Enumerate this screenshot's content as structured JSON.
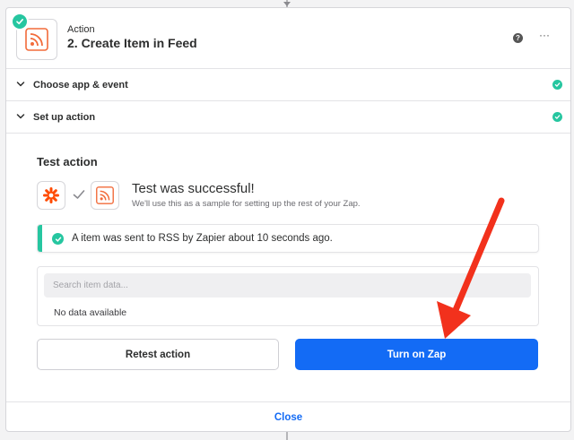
{
  "header": {
    "kicker": "Action",
    "title": "2. Create Item in Feed",
    "help_glyph": "?",
    "more_glyph": "···",
    "app_icon": "rss-icon",
    "status_icon": "success-check-icon"
  },
  "sections": [
    {
      "label": "Choose app & event",
      "complete": true
    },
    {
      "label": "Set up action",
      "complete": true
    }
  ],
  "test": {
    "heading": "Test action",
    "source_icon": "zapier-asterisk-icon",
    "target_icon": "rss-icon",
    "success_title": "Test was successful!",
    "success_subtitle": "We'll use this as a sample for setting up the rest of your Zap.",
    "alert_text": "A item was sent to RSS by Zapier about 10 seconds ago.",
    "search_placeholder": "Search item data...",
    "empty_text": "No data available",
    "retest_label": "Retest action",
    "turn_on_label": "Turn on Zap"
  },
  "footer": {
    "close_label": "Close"
  },
  "colors": {
    "accent_blue": "#136bf5",
    "success_green": "#26c6a0",
    "rss_orange": "#f26b3a",
    "zapier_orange": "#ff4a00",
    "annotation_red": "#f2311c"
  }
}
